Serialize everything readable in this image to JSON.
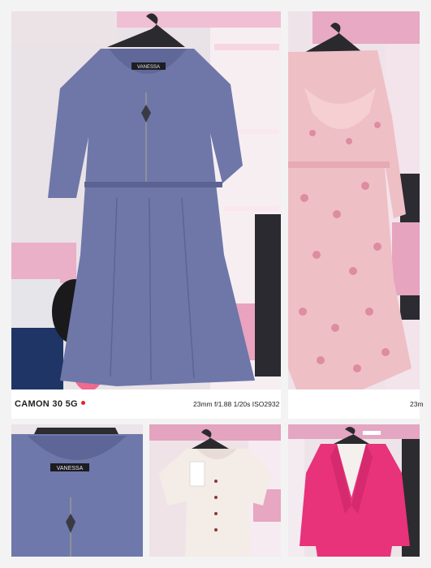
{
  "photos": [
    {
      "subject": "blue-dress",
      "label": "VANESSA"
    },
    {
      "subject": "pink-floral-dress"
    },
    {
      "subject": "blue-dress-closeup",
      "label": "VANESSA"
    },
    {
      "subject": "white-blouse"
    },
    {
      "subject": "pink-blazer"
    }
  ],
  "stamp": {
    "device": "CAMON 30 5G",
    "exif": "23mm f/1.88 1/20s ISO2932",
    "exif_cut": "23m"
  },
  "colors": {
    "page_bg": "#f3f3f4",
    "dress_blue": "#6f78aa",
    "shelf_pink": "#e8a7c3",
    "blazer_pink": "#e8327a",
    "accent_red": "#e0262e"
  }
}
